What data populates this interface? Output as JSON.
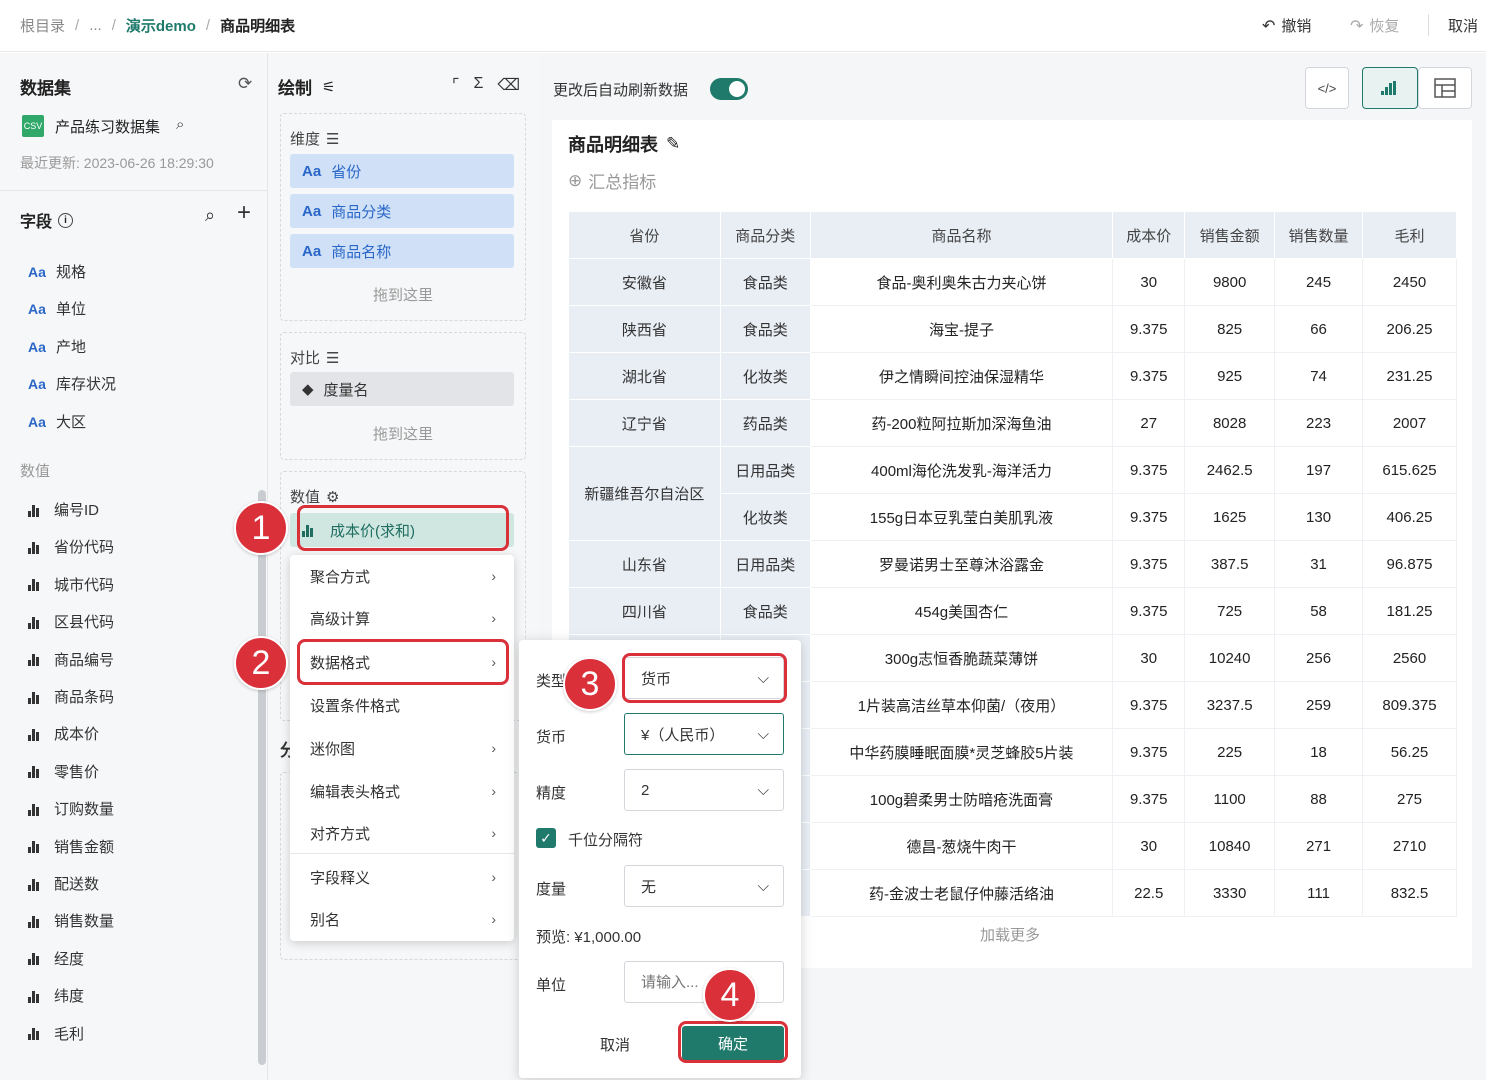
{
  "breadcrumb": {
    "root": "根目录",
    "sep": "/",
    "ellipsis": "...",
    "parent": "演示demo",
    "current": "商品明细表"
  },
  "toolbar": {
    "undo": "撤销",
    "redo": "恢复",
    "cancel": "取消"
  },
  "dataset": {
    "title": "数据集",
    "name": "产品练习数据集",
    "updated": "最近更新: 2023-06-26 18:29:30",
    "fields_title": "字段",
    "dim_fields": [
      "规格",
      "单位",
      "产地",
      "库存状况",
      "大区"
    ],
    "measure_section": "数值",
    "measure_fields": [
      "编号ID",
      "省份代码",
      "城市代码",
      "区县代码",
      "商品编号",
      "商品条码",
      "成本价",
      "零售价",
      "订购数量",
      "销售金额",
      "配送数",
      "销售数量",
      "经度",
      "纬度",
      "毛利"
    ],
    "aa": "Aa"
  },
  "draw": {
    "title": "绘制",
    "dimension_label": "维度",
    "dimensions": [
      "省份",
      "商品分类",
      "商品名称"
    ],
    "drag_hint": "拖到这里",
    "compare_label": "对比",
    "compare_item": "度量名",
    "value_label": "数值",
    "value_item": "成本价(求和)",
    "partial_label": "分"
  },
  "context_menu": [
    "聚合方式",
    "高级计算",
    "数据格式",
    "设置条件格式",
    "迷你图",
    "编辑表头格式",
    "对齐方式",
    "字段释义",
    "别名"
  ],
  "format_panel": {
    "type_label": "类型",
    "type_value": "货币",
    "currency_label": "货币",
    "currency_value": "¥（人民币）",
    "precision_label": "精度",
    "precision_value": "2",
    "thousands_label": "千位分隔符",
    "thousands_checked": true,
    "unit_scale_label": "度量",
    "unit_scale_value": "无",
    "preview": "预览: ¥1,000.00",
    "unit_label": "单位",
    "unit_placeholder": "请输入...",
    "cancel": "取消",
    "confirm": "确定"
  },
  "badges": [
    "1",
    "2",
    "3",
    "4"
  ],
  "canvas": {
    "auto_refresh": "更改后自动刷新数据",
    "auto_refresh_on": true,
    "chart_title": "商品明细表",
    "summary": "汇总指标",
    "load_more": "加载更多"
  },
  "table": {
    "columns": [
      "省份",
      "商品分类",
      "商品名称",
      "成本价",
      "销售金额",
      "销售数量",
      "毛利"
    ],
    "rows": [
      [
        "安徽省",
        "食品类",
        "食品-奥利奥朱古力夹心饼",
        "30",
        "9800",
        "245",
        "2450"
      ],
      [
        "陕西省",
        "食品类",
        "海宝-提子",
        "9.375",
        "825",
        "66",
        "206.25"
      ],
      [
        "湖北省",
        "化妆类",
        "伊之情瞬间控油保湿精华",
        "9.375",
        "925",
        "74",
        "231.25"
      ],
      [
        "辽宁省",
        "药品类",
        "药-200粒阿拉斯加深海鱼油",
        "27",
        "8028",
        "223",
        "2007"
      ],
      [
        "新疆维吾尔自治区",
        "日用品类",
        "400ml海伦洗发乳-海洋活力",
        "9.375",
        "2462.5",
        "197",
        "615.625"
      ],
      [
        "",
        "化妆类",
        "155g日本豆乳莹白美肌乳液",
        "9.375",
        "1625",
        "130",
        "406.25"
      ],
      [
        "山东省",
        "日用品类",
        "罗曼诺男士至尊沐浴露金",
        "9.375",
        "387.5",
        "31",
        "96.875"
      ],
      [
        "四川省",
        "食品类",
        "454g美国杏仁",
        "9.375",
        "725",
        "58",
        "181.25"
      ],
      [
        "",
        "",
        "300g志恒香脆蔬菜薄饼",
        "30",
        "10240",
        "256",
        "2560"
      ],
      [
        "",
        "",
        "1片装高洁丝草本仰菌/（夜用）",
        "9.375",
        "3237.5",
        "259",
        "809.375"
      ],
      [
        "",
        "",
        "中华药膜睡眠面膜*灵芝蜂胶5片装",
        "9.375",
        "225",
        "18",
        "56.25"
      ],
      [
        "",
        "",
        "100g碧柔男士防暗疮洗面膏",
        "9.375",
        "1100",
        "88",
        "275"
      ],
      [
        "",
        "",
        "德昌-葱烧牛肉干",
        "30",
        "10840",
        "271",
        "2710"
      ],
      [
        "",
        "",
        "药-金波士老鼠仔仲藤活络油",
        "22.5",
        "3330",
        "111",
        "832.5"
      ]
    ]
  }
}
